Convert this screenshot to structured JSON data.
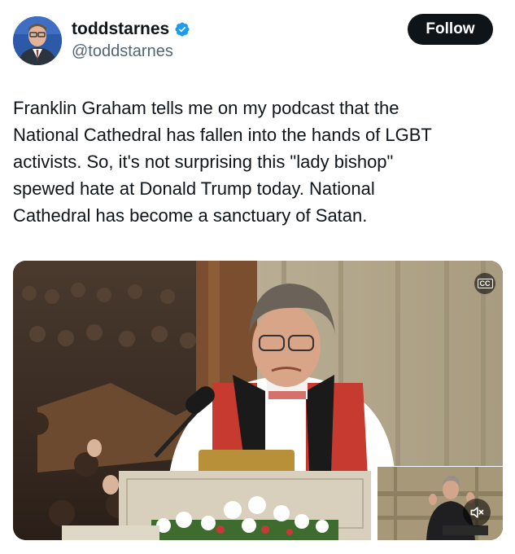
{
  "user": {
    "display_name": "toddstarnes",
    "handle": "@toddstarnes",
    "verified": true
  },
  "follow_button": {
    "label": "Follow"
  },
  "tweet": {
    "text": "Franklin Graham tells me on my podcast that the\nNational Cathedral has fallen into the hands of LGBT\nactivists. So, it's not surprising this \"lady bishop\"\nspewed hate at Donald Trump today. National\nCathedral has become a sanctuary of Satan."
  },
  "media": {
    "captions_label": "CC"
  },
  "colors": {
    "verified_blue": "#1d9bf0",
    "button_bg": "#0f1419",
    "handle_gray": "#536471"
  },
  "icons": {
    "verified": "verified-badge-icon",
    "captions": "closed-captions-icon",
    "mute": "speaker-muted-icon"
  }
}
